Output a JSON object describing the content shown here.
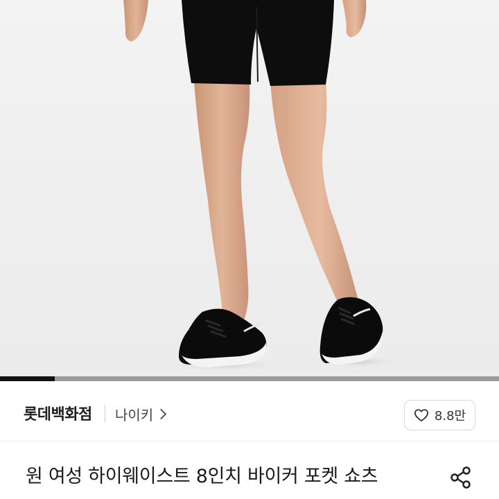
{
  "product": {
    "image_alt": "black bike shorts worn with black sneakers",
    "image_count_progress": 0.11
  },
  "brand": {
    "store_name": "롯데백화점",
    "brand_name": "나이키",
    "chevron_icon": "chevron-right-icon"
  },
  "like": {
    "icon": "heart-icon",
    "count": "8.8만"
  },
  "title": {
    "text": "원 여성 하이웨이스트 8인치 바이커 포켓 쇼츠",
    "share_icon": "share-icon"
  },
  "colors": {
    "progress_fill": "#111111",
    "progress_track": "#9a9a9a",
    "text_primary": "#1a1a1a"
  }
}
